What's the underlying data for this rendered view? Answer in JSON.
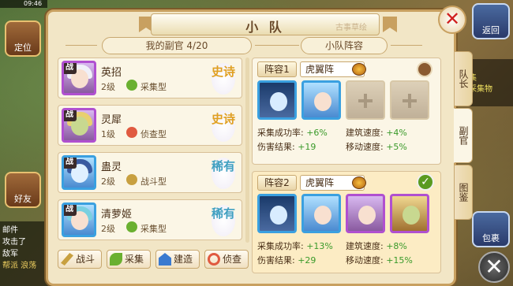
{
  "background": {
    "status_time": "09:46",
    "left_buttons": [
      "定位",
      "好友"
    ],
    "chat_lines": [
      "邮件",
      "攻击了",
      "敌军",
      "帮派 浪荡"
    ],
    "right_buttons": [
      "返回",
      "包裹"
    ],
    "quest_lines": [
      "务",
      "采集",
      "的采集物"
    ]
  },
  "dialog": {
    "title": "小 队",
    "title_deco": "古事草绘"
  },
  "left_panel": {
    "header": "我的副官 4/20",
    "officers": [
      {
        "name": "英招",
        "level": "2级",
        "type": "采集型",
        "rarity": "史诗",
        "rarity_class": "epic",
        "frame": "purple"
      },
      {
        "name": "灵犀",
        "level": "1级",
        "type": "侦查型",
        "rarity": "史诗",
        "rarity_class": "epic",
        "frame": "purple"
      },
      {
        "name": "蛊灵",
        "level": "2级",
        "type": "战斗型",
        "rarity": "稀有",
        "rarity_class": "rare",
        "frame": "blue"
      },
      {
        "name": "清萝姬",
        "level": "2级",
        "type": "采集型",
        "rarity": "稀有",
        "rarity_class": "rare",
        "frame": "blue"
      }
    ],
    "battle_badge": "战",
    "buttons": [
      "战斗",
      "采集",
      "建造",
      "侦查"
    ]
  },
  "right_panel": {
    "header": "小队阵容",
    "lineups": [
      {
        "tag": "阵容1",
        "formation": "虎翼阵",
        "stats": [
          {
            "label": "采集成功率:",
            "value": "+6%"
          },
          {
            "label": "建筑速度:",
            "value": "+4%"
          },
          {
            "label": "伤害结果:",
            "value": "+19"
          },
          {
            "label": "移动速度:",
            "value": "+5%"
          }
        ]
      },
      {
        "tag": "阵容2",
        "formation": "虎翼阵",
        "stats": [
          {
            "label": "采集成功率:",
            "value": "+13%"
          },
          {
            "label": "建筑速度:",
            "value": "+8%"
          },
          {
            "label": "伤害结果:",
            "value": "+29"
          },
          {
            "label": "移动速度:",
            "value": "+15%"
          }
        ]
      }
    ]
  },
  "side_tabs": [
    "队长",
    "副官",
    "图鉴"
  ]
}
